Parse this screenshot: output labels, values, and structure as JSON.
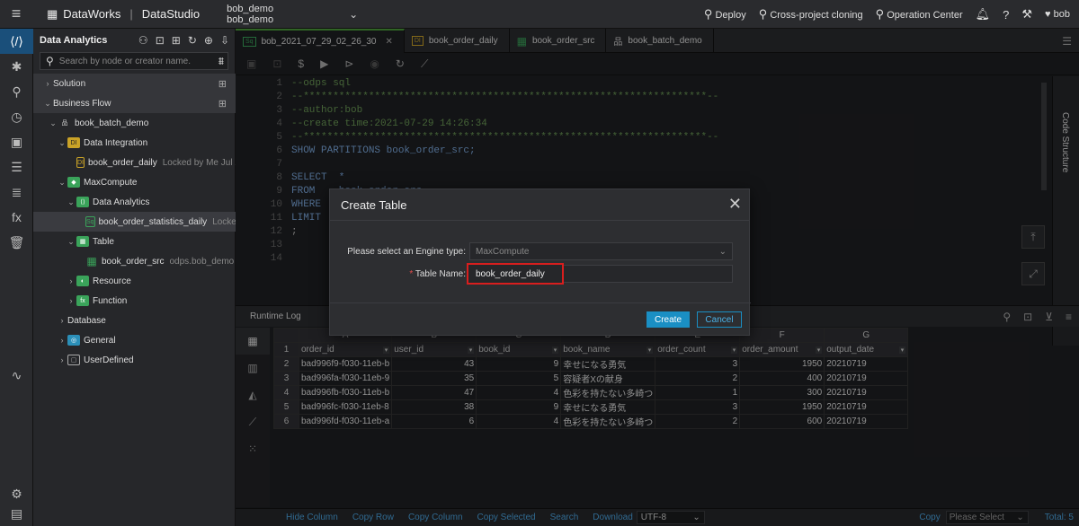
{
  "header": {
    "brand": "DataWorks",
    "product": "DataStudio",
    "workspace_line1": "bob_demo",
    "workspace_line2": "bob_demo",
    "links": [
      "Deploy",
      "Cross-project cloning",
      "Operation Center"
    ],
    "user": "bob"
  },
  "sidebar": {
    "title": "Data Analytics",
    "search_placeholder": "Search by node or creator name.",
    "tree": [
      {
        "label": "Solution",
        "meta": ""
      },
      {
        "label": "Business Flow",
        "meta": ""
      },
      {
        "label": "book_batch_demo",
        "meta": ""
      },
      {
        "label": "Data Integration",
        "meta": ""
      },
      {
        "label": "book_order_daily",
        "meta": "Locked by Me   Jul 29"
      },
      {
        "label": "MaxCompute",
        "meta": ""
      },
      {
        "label": "Data Analytics",
        "meta": ""
      },
      {
        "label": "book_order_statistics_daily",
        "meta": "Locked"
      },
      {
        "label": "Table",
        "meta": ""
      },
      {
        "label": "book_order_src",
        "meta": "odps.bob_demo"
      },
      {
        "label": "Resource",
        "meta": ""
      },
      {
        "label": "Function",
        "meta": ""
      },
      {
        "label": "Database",
        "meta": ""
      },
      {
        "label": "General",
        "meta": ""
      },
      {
        "label": "UserDefined",
        "meta": ""
      }
    ]
  },
  "tabs": [
    {
      "label": "bob_2021_07_29_02_26_30",
      "badge": "Sq"
    },
    {
      "label": "book_order_daily",
      "badge": "DI"
    },
    {
      "label": "book_order_src",
      "badge": ""
    },
    {
      "label": "book_batch_demo",
      "badge": ""
    }
  ],
  "code": {
    "line_numbers": [
      "1",
      "2",
      "3",
      "4",
      "5",
      "6",
      "7",
      "8",
      "9",
      "10",
      "11",
      "12",
      "13",
      "14"
    ],
    "lines": [
      "--odps sql",
      "--********************************************************************--",
      "--author:bob",
      "--create time:2021-07-29 14:26:34",
      "--********************************************************************--",
      "SHOW PARTITIONS book_order_src;",
      "",
      "SELECT  *",
      "FROM    book_order_src",
      "WHERE",
      "LIMIT",
      ";",
      "",
      ""
    ],
    "code_structure_label": "Code Structure"
  },
  "log": {
    "title": "Runtime Log"
  },
  "results": {
    "col_letters": [
      "",
      "A",
      "B",
      "C",
      "D",
      "E",
      "F",
      "G"
    ],
    "columns": [
      "order_id",
      "user_id",
      "book_id",
      "book_name",
      "order_count",
      "order_amount",
      "output_date"
    ],
    "rows": [
      [
        "1",
        "bad996f9-f030-11eb-b",
        "43",
        "9",
        "幸せになる勇気",
        "3",
        "1950",
        "20210719"
      ],
      [
        "2",
        "bad996fa-f030-11eb-9",
        "35",
        "5",
        "容疑者Xの献身",
        "2",
        "400",
        "20210719"
      ],
      [
        "3",
        "bad996fb-f030-11eb-b",
        "47",
        "4",
        "色彩を持たない多崎つ",
        "1",
        "300",
        "20210719"
      ],
      [
        "4",
        "bad996fc-f030-11eb-8",
        "38",
        "9",
        "幸せになる勇気",
        "3",
        "1950",
        "20210719"
      ],
      [
        "5",
        "bad996fd-f030-11eb-a",
        "6",
        "4",
        "色彩を持たない多崎つ",
        "2",
        "600",
        "20210719"
      ]
    ],
    "row_numbers": [
      "1",
      "2",
      "3",
      "4",
      "5",
      "6"
    ]
  },
  "bottom": {
    "actions": [
      "Hide Column",
      "Copy Row",
      "Copy Column",
      "Copy Selected",
      "Search",
      "Download"
    ],
    "encoding": "UTF-8",
    "copy_label": "Copy",
    "copy_placeholder": "Please Select",
    "total": "Total: 5"
  },
  "dialog": {
    "title": "Create Table",
    "engine_label": "Please select an Engine type:",
    "engine_value": "MaxCompute",
    "name_label": "Table Name:",
    "name_value": "book_order_daily",
    "create_label": "Create",
    "cancel_label": "Cancel"
  }
}
